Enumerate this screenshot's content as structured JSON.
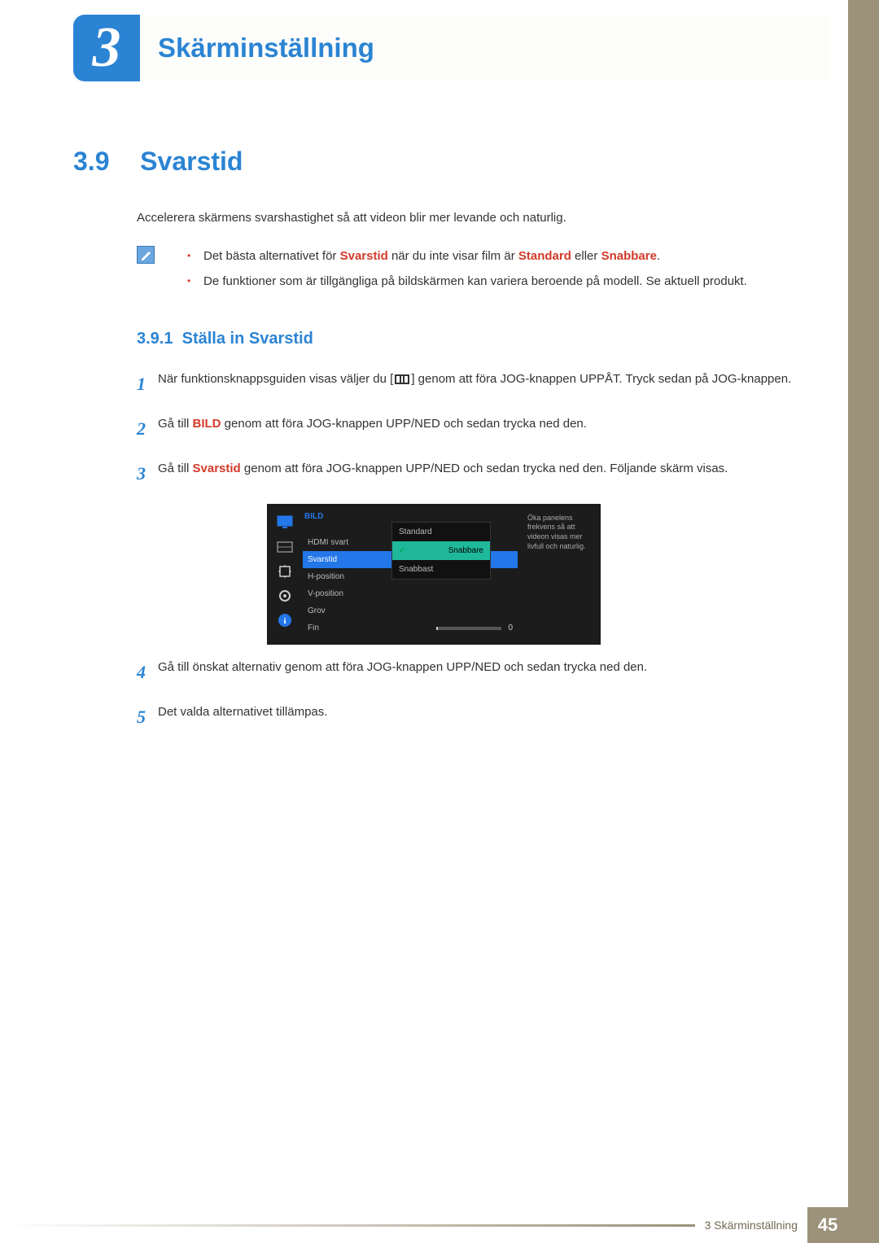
{
  "header": {
    "chapter_number": "3",
    "chapter_title": "Skärminställning"
  },
  "section": {
    "number": "3.9",
    "title": "Svarstid",
    "intro": "Accelerera skärmens svarshastighet så att videon blir mer levande och naturlig."
  },
  "notes": {
    "item1_pre": "Det bästa alternativet för ",
    "item1_em1": "Svarstid",
    "item1_mid": " när du inte visar film är ",
    "item1_em2": "Standard",
    "item1_or": " eller ",
    "item1_em3": "Snabbare",
    "item1_end": ".",
    "item2": "De funktioner som är tillgängliga på bildskärmen kan variera beroende på modell. Se aktuell produkt."
  },
  "subsection": {
    "number": "3.9.1",
    "title": "Ställa in Svarstid"
  },
  "steps": {
    "s1_a": "När funktionsknappsguiden visas väljer du [",
    "s1_b": "] genom att föra JOG-knappen UPPÅT. Tryck sedan på JOG-knappen.",
    "s2_a": "Gå till ",
    "s2_em": "BILD",
    "s2_b": " genom att föra JOG-knappen UPP/NED och sedan trycka ned den.",
    "s3_a": "Gå till ",
    "s3_em": "Svarstid",
    "s3_b": " genom att föra JOG-knappen UPP/NED och sedan trycka ned den. Följande skärm visas.",
    "s4": "Gå till önskat alternativ genom att föra JOG-knappen UPP/NED och sedan trycka ned den.",
    "s5": "Det valda alternativet tillämpas."
  },
  "osd": {
    "title": "BILD",
    "items": [
      "HDMI svart",
      "Svarstid",
      "H-position",
      "V-position",
      "Grov",
      "Fin"
    ],
    "fin_value": "0",
    "popup": [
      "Standard",
      "Snabbare",
      "Snabbast"
    ],
    "desc": "Öka panelens frekvens så att videon visas mer livfull och naturlig."
  },
  "footer": {
    "label": "3 Skärminställning",
    "page": "45"
  }
}
